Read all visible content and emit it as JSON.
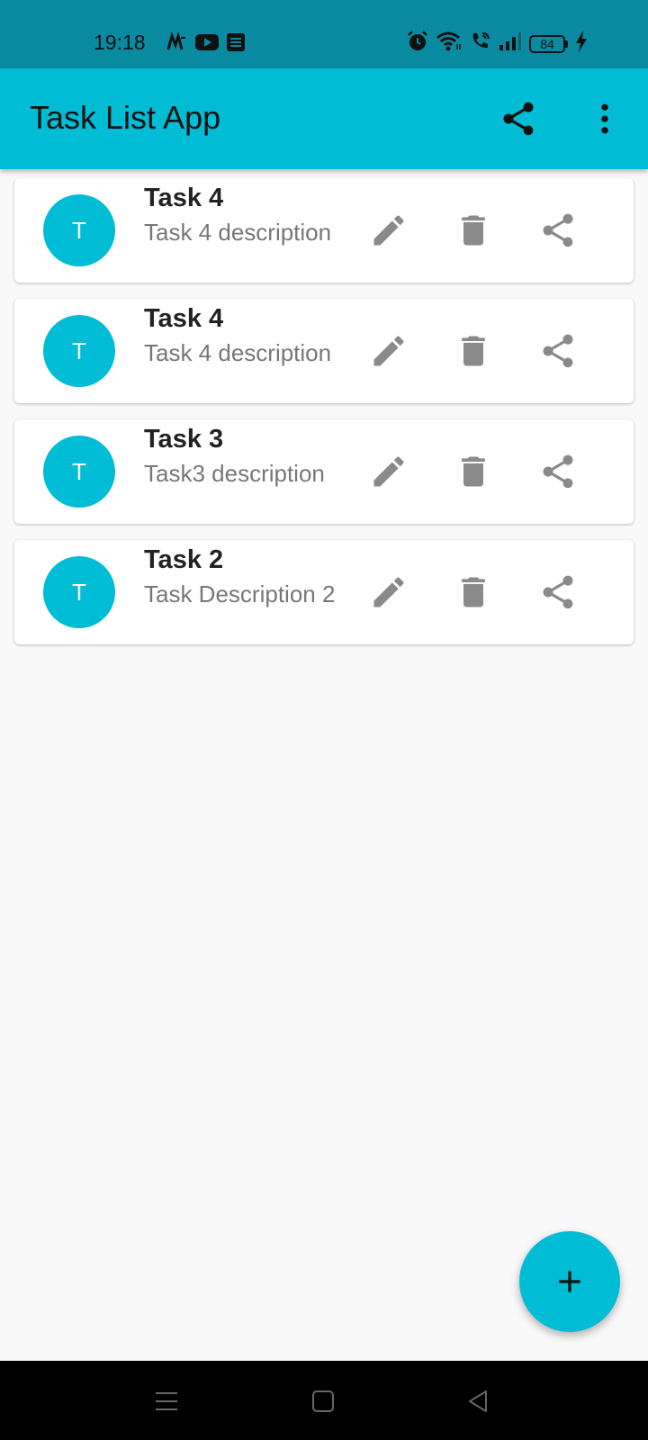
{
  "status_bar": {
    "time": "19:18",
    "battery": "84",
    "left_icons": [
      "myntra-icon",
      "youtube-icon",
      "news-icon"
    ],
    "right_icons": [
      "alarm-icon",
      "wifi-icon",
      "wifi-call-icon",
      "signal-icon",
      "battery-icon",
      "charging-icon"
    ]
  },
  "app_bar": {
    "title": "Task List App",
    "actions": [
      "share-icon",
      "more-vert-icon"
    ],
    "color": "#00bcd4"
  },
  "tasks": [
    {
      "avatar": "T",
      "title": "Task 4",
      "description": "Task 4 description"
    },
    {
      "avatar": "T",
      "title": "Task 4",
      "description": "Task 4 description"
    },
    {
      "avatar": "T",
      "title": "Task 3",
      "description": "Task3 description"
    },
    {
      "avatar": "T",
      "title": "Task 2",
      "description": "Task Description 2"
    }
  ],
  "task_actions": [
    "edit-icon",
    "delete-icon",
    "share-icon"
  ],
  "fab": {
    "icon": "add-icon"
  },
  "nav_bar": {
    "buttons": [
      "menu-icon",
      "home-icon",
      "back-icon"
    ]
  },
  "colors": {
    "accent": "#00bcd4",
    "status_bar": "#0a8aa0",
    "icon_grey": "#8a8a8a"
  }
}
